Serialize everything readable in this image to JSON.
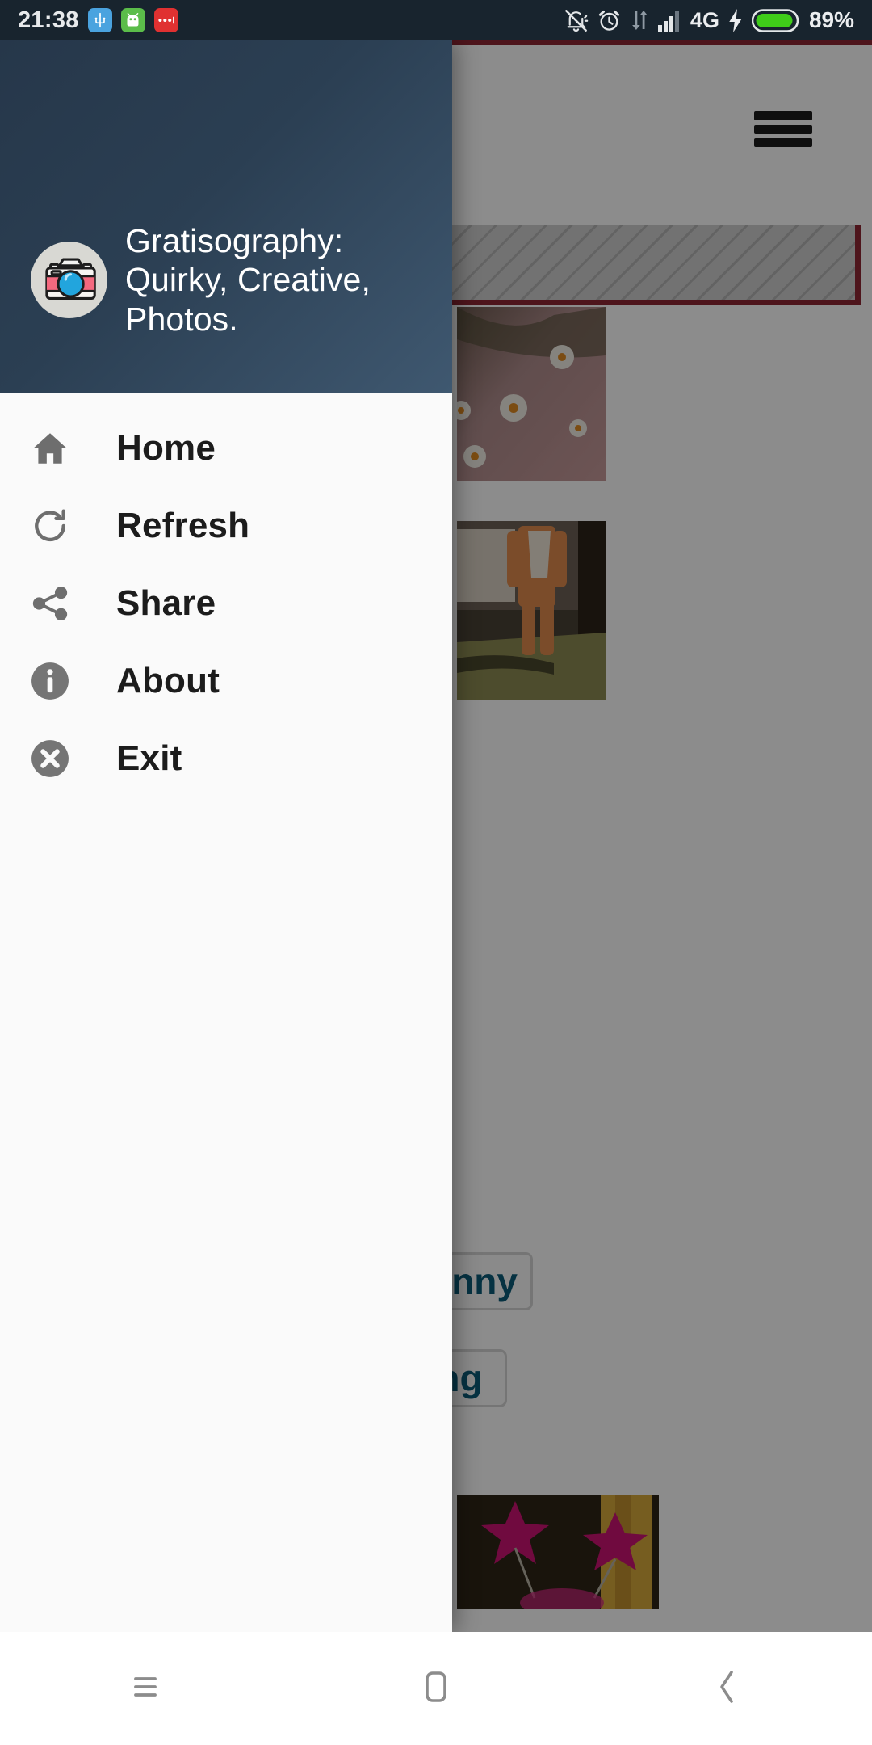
{
  "status_bar": {
    "time": "21:38",
    "left_icons": [
      {
        "name": "usb-icon",
        "color": "#4aa3df"
      },
      {
        "name": "android-debug-icon",
        "color": "#5bbd4a"
      },
      {
        "name": "more-dots-icon",
        "color": "#e03131"
      }
    ],
    "right_icons": [
      {
        "name": "bell-off-icon"
      },
      {
        "name": "alarm-clock-icon"
      },
      {
        "name": "data-transfer-icon"
      },
      {
        "name": "signal-bars-icon"
      }
    ],
    "network": "4G",
    "charging": true,
    "battery_percent": "89%",
    "battery_color": "#3fcc19",
    "background": "#18242e"
  },
  "drawer": {
    "app_title": "Gratisography: Quirky, Creative, Photos.",
    "logo_icon": "camera-icon",
    "header_gradient_from": "#26374a",
    "header_gradient_to": "#3f5870",
    "menu_items": [
      {
        "label": "Home",
        "icon": "home-icon"
      },
      {
        "label": "Refresh",
        "icon": "refresh-icon"
      },
      {
        "label": "Share",
        "icon": "share-icon"
      },
      {
        "label": "About",
        "icon": "info-circle-icon"
      },
      {
        "label": "Exit",
        "icon": "close-circle-icon"
      }
    ]
  },
  "page": {
    "menu_button_icon": "hamburger-icon",
    "accent_color": "#8f2733",
    "ad_placeholder_label": "",
    "chips": [
      {
        "label": "Funny"
      },
      {
        "label": "ving"
      }
    ],
    "thumbnails": [
      {
        "name": "daisy-flowers-photo"
      },
      {
        "name": "orange-clothesline-photo"
      },
      {
        "name": "pink-stars-photo"
      }
    ]
  },
  "nav_bar": {
    "buttons": [
      {
        "name": "recents-button",
        "icon": "recents-icon"
      },
      {
        "name": "home-button",
        "icon": "home-square-icon"
      },
      {
        "name": "back-button",
        "icon": "back-chevron-icon"
      }
    ]
  }
}
